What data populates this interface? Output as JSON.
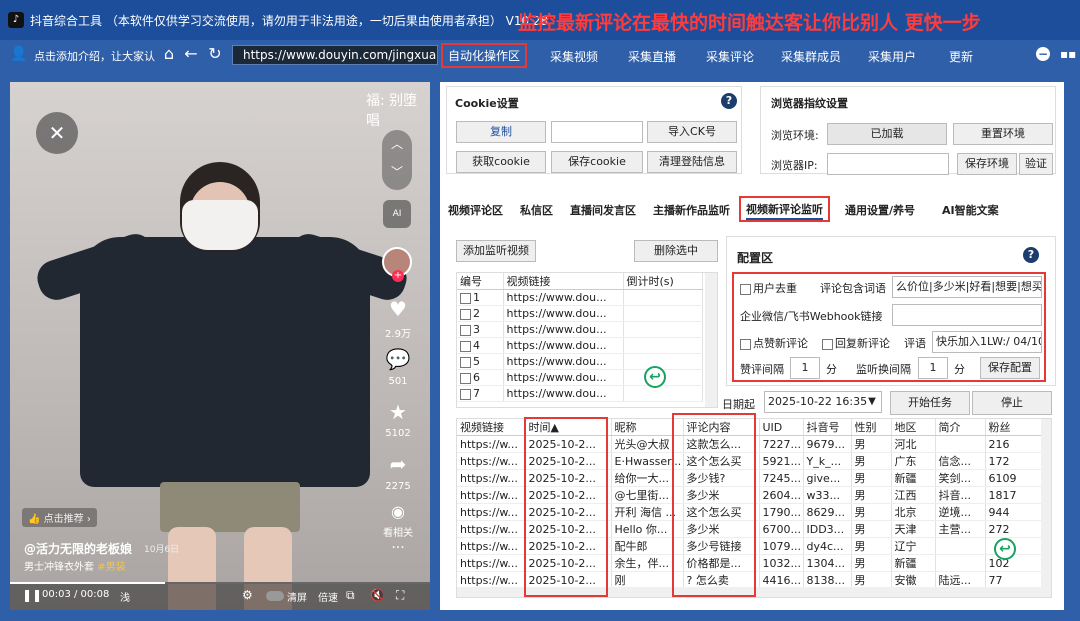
{
  "titlebar": {
    "app": "抖音综合工具 （本软件仅供学习交流使用，请勿用于非法用途，一切后果由使用者承担） V10.28",
    "promo": "监控最新评论在最快的时间触达客让你比别人 更快一步"
  },
  "navbar": {
    "intro": "点击添加介绍，让大家认",
    "url": "https://www.douyin.com/jingxuan",
    "tabs": [
      "自动化操作区",
      "采集视频",
      "采集直播",
      "采集评论",
      "采集群成员",
      "采集用户",
      "更新"
    ],
    "active_tab": 0
  },
  "video": {
    "watermark": "福: 别堕唱",
    "likes": "2.9万",
    "comments": "501",
    "favorites": "5102",
    "shares": "2275",
    "related": "看相关",
    "recommend": "点击推荐",
    "author": "@活力无限的老板娘",
    "date": "10月6日",
    "desc": "男士冲锋衣外套",
    "tag": "#男装",
    "time": "00:03 / 00:08",
    "speed_icon_label": "浅",
    "clear": "清屏",
    "speed": "倍速",
    "progress": 0.37
  },
  "cookie": {
    "title": "Cookie设置",
    "copy": "复制",
    "cookie_value": "",
    "import": "导入CK号",
    "get": "获取cookie",
    "save": "保存cookie",
    "clear": "清理登陆信息"
  },
  "browser": {
    "title": "浏览器指纹设置",
    "env_label": "浏览环境:",
    "env_value": "已加载",
    "reset": "重置环境",
    "ip_label": "浏览器IP:",
    "ip_value": "",
    "save_env": "保存环境",
    "verify": "验证"
  },
  "subtabs": [
    "视频评论区",
    "私信区",
    "直播间发言区",
    "主播新作品监听",
    "视频新评论监听",
    "通用设置/养号",
    "AI智能文案"
  ],
  "subtab_active": 4,
  "monitor": {
    "add": "添加监听视频",
    "delete": "删除选中",
    "columns": [
      "编号",
      "视频链接",
      "倒计时(s)"
    ],
    "rows": [
      {
        "id": "1",
        "url": "https://www.dou..."
      },
      {
        "id": "2",
        "url": "https://www.dou..."
      },
      {
        "id": "3",
        "url": "https://www.dou..."
      },
      {
        "id": "4",
        "url": "https://www.dou..."
      },
      {
        "id": "5",
        "url": "https://www.dou..."
      },
      {
        "id": "6",
        "url": "https://www.dou..."
      },
      {
        "id": "7",
        "url": "https://www.dou..."
      }
    ]
  },
  "config": {
    "title": "配置区",
    "dedupe": "用户去重",
    "keyword_label": "评论包含词语",
    "keywords": "么价位|多少米|好看|想要|想买",
    "webhook_label": "企业微信/飞书Webhook链接",
    "webhook": "",
    "like_new": "点赞新评论",
    "reply_new": "回复新评论",
    "reply_label": "评语",
    "reply_text": "快乐加入1LW:/ 04/10",
    "interval_label": "赞评间隔",
    "interval": "1",
    "unit1": "分",
    "listen_label": "监听换间隔",
    "listen": "1",
    "unit2": "分",
    "save": "保存配置"
  },
  "task": {
    "date_label": "日期起",
    "date": "2025-10-22 16:35",
    "start": "开始任务",
    "stop": "停止"
  },
  "results": {
    "columns": [
      "视频链接",
      "时间▲",
      "昵称",
      "评论内容",
      "UID",
      "抖音号",
      "性别",
      "地区",
      "简介",
      "粉丝"
    ],
    "rows": [
      [
        "https://w...",
        "2025-10-2...",
        "光头@大叔",
        "这款怎么...",
        "7227...",
        "9679...",
        "男",
        "河北",
        "",
        "216"
      ],
      [
        "https://w...",
        "2025-10-2...",
        "E·Hwasser...",
        "这个怎么买",
        "5921...",
        "Y_k_...",
        "男",
        "广东",
        "信念...",
        "172"
      ],
      [
        "https://w...",
        "2025-10-2...",
        "给你一大...",
        "多少钱?",
        "7245...",
        "give...",
        "男",
        "新疆",
        "笑剑...",
        "6109"
      ],
      [
        "https://w...",
        "2025-10-2...",
        "@七里街...",
        "多少米",
        "2604...",
        "w33...",
        "男",
        "江西",
        "抖音...",
        "1817"
      ],
      [
        "https://w...",
        "2025-10-2...",
        "开利 海信 ...",
        "这个怎么买",
        "1790...",
        "8629...",
        "男",
        "北京",
        "逆境...",
        "944"
      ],
      [
        "https://w...",
        "2025-10-2...",
        "Hello  你...",
        "多少米",
        "6700...",
        "IDD3...",
        "男",
        "天津",
        "主营...",
        "272"
      ],
      [
        "https://w...",
        "2025-10-2...",
        "配牛郎",
        "多少号链接",
        "1079...",
        "dy4c...",
        "男",
        "辽宁",
        "",
        ""
      ],
      [
        "https://w...",
        "2025-10-2...",
        "余生，伴...",
        "价格都是...",
        "1032...",
        "1304...",
        "男",
        "新疆",
        "",
        "102"
      ],
      [
        "https://w...",
        "2025-10-2...",
        "刚",
        "?  怎么卖",
        "4416...",
        "8138...",
        "男",
        "安徽",
        "陆远...",
        "77"
      ]
    ]
  },
  "colors": {
    "titlebar": "#1c4e9c",
    "accent_red": "#e53935",
    "promo_red": "#ff3b3b"
  }
}
